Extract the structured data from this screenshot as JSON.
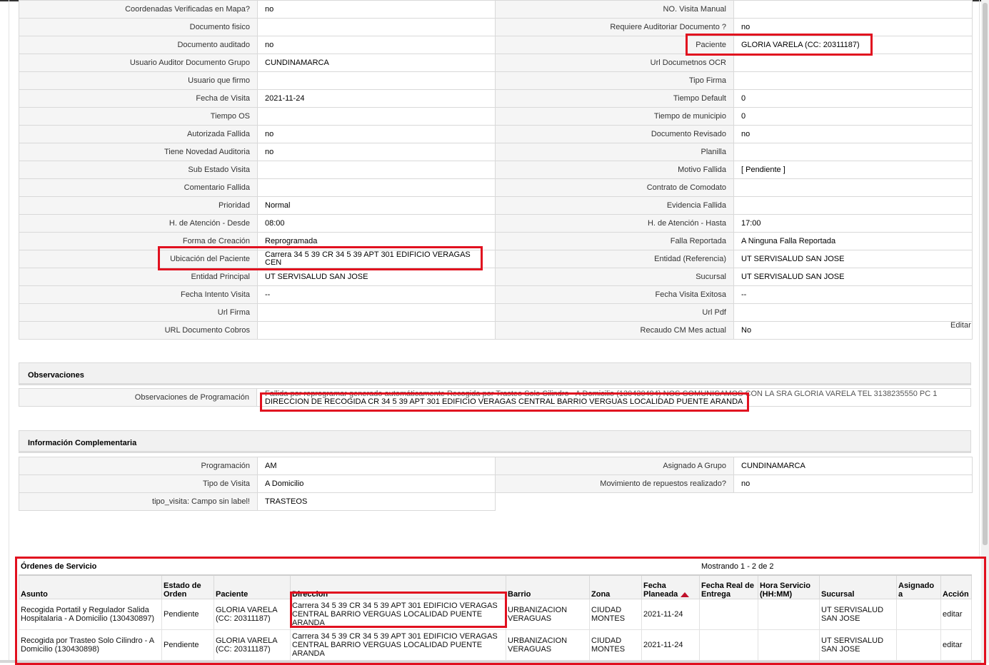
{
  "details": {
    "rows": [
      {
        "l1": "Coordenadas Verificadas en Mapa?",
        "v1": "no",
        "l2": "NO. Visita Manual",
        "v2": ""
      },
      {
        "l1": "Documento fisico",
        "v1": "",
        "l2": "Requiere Auditoriar Documento ?",
        "v2": "no"
      },
      {
        "l1": "Documento auditado",
        "v1": "no",
        "l2": "Paciente",
        "v2": "GLORIA VARELA (CC: 20311187)"
      },
      {
        "l1": "Usuario Auditor Documento Grupo",
        "v1": "CUNDINAMARCA",
        "l2": "Url Documetnos OCR",
        "v2": ""
      },
      {
        "l1": "Usuario que firmo",
        "v1": "",
        "l2": "Tipo Firma",
        "v2": ""
      },
      {
        "l1": "Fecha de Visita",
        "v1": "2021-11-24",
        "l2": "Tiempo Default",
        "v2": "0"
      },
      {
        "l1": "Tiempo OS",
        "v1": "",
        "l2": "Tiempo de municipio",
        "v2": "0"
      },
      {
        "l1": "Autorizada Fallida",
        "v1": "no",
        "l2": "Documento Revisado",
        "v2": "no"
      },
      {
        "l1": "Tiene Novedad Auditoria",
        "v1": "no",
        "l2": "Planilla",
        "v2": ""
      },
      {
        "l1": "Sub Estado Visita",
        "v1": "",
        "l2": "Motivo Fallida",
        "v2": "[ Pendiente ]"
      },
      {
        "l1": "Comentario Fallida",
        "v1": "",
        "l2": "Contrato de Comodato",
        "v2": ""
      },
      {
        "l1": "Prioridad",
        "v1": "Normal",
        "l2": "Evidencia Fallida",
        "v2": ""
      },
      {
        "l1": "H. de Atención - Desde",
        "v1": "08:00",
        "l2": "H. de Atención - Hasta",
        "v2": "17:00"
      },
      {
        "l1": "Forma de Creación",
        "v1": "Reprogramada",
        "l2": "Falla Reportada",
        "v2": "A Ninguna Falla Reportada"
      },
      {
        "l1": "Ubicación del Paciente",
        "v1": "Carrera 34 5 39 CR 34 5 39 APT 301 EDIFICIO VERAGAS CEN",
        "l2": "Entidad (Referencia)",
        "v2": "UT SERVISALUD SAN JOSE"
      },
      {
        "l1": "Entidad Principal",
        "v1": "UT SERVISALUD SAN JOSE",
        "l2": "Sucursal",
        "v2": "UT SERVISALUD SAN JOSE"
      },
      {
        "l1": "Fecha Intento Visita",
        "v1": "--",
        "l2": "Fecha Visita Exitosa",
        "v2": "--"
      },
      {
        "l1": "Url Firma",
        "v1": "",
        "l2": "Url Pdf",
        "v2": ""
      },
      {
        "l1": "URL Documento Cobros",
        "v1": "",
        "l2": "Recaudo CM Mes actual",
        "v2": "No"
      }
    ],
    "edit_label": "Editar"
  },
  "observaciones": {
    "title": "Observaciones",
    "label": "Observaciones de Programación",
    "line1": "Fallida por reprogramar generado automáticamente Recogida por Trasteo Solo Cilindro - A Domicilio (130430494) NOS COMUNICAMOS CON LA SRA GLORIA VARELA TEL 3138235550 PC 1",
    "line2": "DIRECCION DE RECOGIDA CR 34 5 39 APT 301 EDIFICIO VERAGAS CENTRAL BARRIO VERGUAS LOCALIDAD PUENTE ARANDA"
  },
  "complementaria": {
    "title": "Información Complementaria",
    "rows": [
      {
        "l1": "Programación",
        "v1": "AM",
        "l2": "Asignado A Grupo",
        "v2": "CUNDINAMARCA"
      },
      {
        "l1": "Tipo de Visita",
        "v1": "A Domicilio",
        "l2": "Movimiento de repuestos realizado?",
        "v2": "no"
      },
      {
        "l1": "tipo_visita: Campo sin label!",
        "v1": "TRASTEOS"
      }
    ]
  },
  "orders": {
    "title": "Órdenes de Servicio",
    "count": "Mostrando 1 - 2 de 2",
    "headers": [
      "Asunto",
      "Estado de Orden",
      "Paciente",
      "Direccion",
      "Barrio",
      "Zona",
      "Fecha Planeada",
      "Fecha Real de Entrega",
      "Hora Servicio (HH:MM)",
      "Sucursal",
      "Asignado a",
      "Acción"
    ],
    "rows": [
      [
        "Recogida Portatil y Regulador Salida Hospitalaria - A Domicilio (130430897)",
        "Pendiente",
        "GLORIA VARELA (CC: 20311187)",
        "Carrera 34 5 39 CR 34 5 39 APT 301 EDIFICIO VERAGAS CENTRAL BARRIO VERGUAS LOCALIDAD PUENTE ARANDA",
        "URBANIZACION VERAGUAS",
        "CIUDAD MONTES",
        "2021-11-24",
        "",
        "",
        "UT SERVISALUD SAN JOSE",
        "",
        "editar"
      ],
      [
        "Recogida por Trasteo Solo Cilindro - A Domicilio (130430898)",
        "Pendiente",
        "GLORIA VARELA (CC: 20311187)",
        "Carrera 34 5 39 CR 34 5 39 APT 301 EDIFICIO VERAGAS CENTRAL BARRIO VERGUAS LOCALIDAD PUENTE ARANDA",
        "URBANIZACION VERAGUAS",
        "CIUDAD MONTES",
        "2021-11-24",
        "",
        "",
        "UT SERVISALUD SAN JOSE",
        "",
        "editar"
      ]
    ]
  }
}
